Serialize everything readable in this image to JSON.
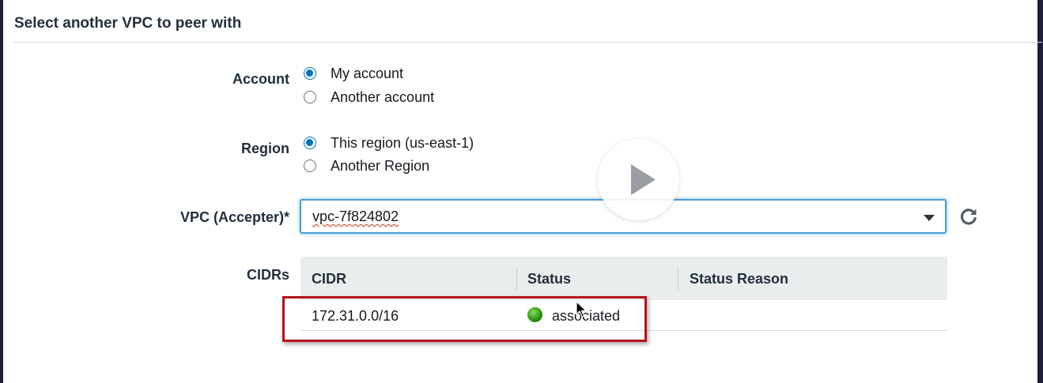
{
  "section": {
    "title": "Select another VPC to peer with"
  },
  "account": {
    "label": "Account",
    "options": [
      "My account",
      "Another account"
    ],
    "selected": "My account"
  },
  "region": {
    "label": "Region",
    "options": [
      "This region (us-east-1)",
      "Another Region"
    ],
    "selected": "This region (us-east-1)"
  },
  "vpc": {
    "label": "VPC (Accepter)*",
    "value": "vpc-7f824802"
  },
  "cidrs": {
    "label": "CIDRs",
    "columns": [
      "CIDR",
      "Status",
      "Status Reason"
    ],
    "rows": [
      {
        "cidr": "172.31.0.0/16",
        "status": "associated",
        "status_reason": ""
      }
    ]
  },
  "colors": {
    "accent": "#0073bb",
    "status_ok": "#1d8102",
    "highlight": "#b3121f"
  },
  "icons": {
    "refresh": "refresh-icon",
    "caret": "caret-down-icon",
    "play": "play-icon",
    "status": "status-ok-icon"
  }
}
